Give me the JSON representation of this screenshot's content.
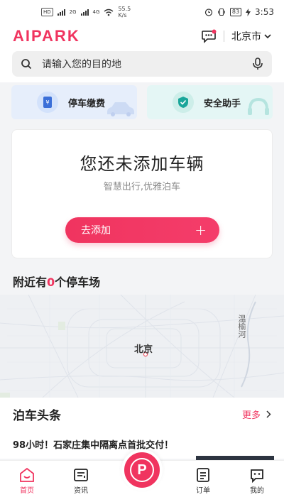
{
  "status_bar": {
    "hd_badge": "HD",
    "net1": "2G",
    "net2": "4G",
    "speed_value": "55.5",
    "speed_unit": "K/s",
    "battery": "83",
    "time": "3:53"
  },
  "header": {
    "logo": "AIPARK",
    "city": "北京市",
    "accent_color": "#f0345f"
  },
  "search": {
    "placeholder": "请输入您的目的地"
  },
  "quick_actions": [
    {
      "label": "停车缴费",
      "icon": "parking-pay-icon"
    },
    {
      "label": "安全助手",
      "icon": "shield-check-icon"
    }
  ],
  "vehicle_card": {
    "title": "您还未添加车辆",
    "subtitle": "智慧出行,优雅泊车",
    "button_label": "去添加",
    "button_icon": "+"
  },
  "nearby": {
    "prefix": "附近有",
    "count": "0",
    "suffix": "个停车场"
  },
  "map": {
    "city_label": "北京",
    "river_label": "温榆河"
  },
  "news": {
    "title": "泊车头条",
    "more": "更多",
    "items": [
      {
        "title": "98小时！石家庄集中隔离点首批交付！"
      }
    ]
  },
  "bottom_nav": {
    "items": [
      {
        "label": "首页",
        "icon": "home-icon",
        "active": true
      },
      {
        "label": "资讯",
        "icon": "news-icon",
        "active": false
      },
      {
        "label": "",
        "icon": "parking-icon",
        "active": false
      },
      {
        "label": "订单",
        "icon": "order-icon",
        "active": false
      },
      {
        "label": "我的",
        "icon": "profile-icon",
        "active": false
      }
    ],
    "center_glyph": "P"
  }
}
